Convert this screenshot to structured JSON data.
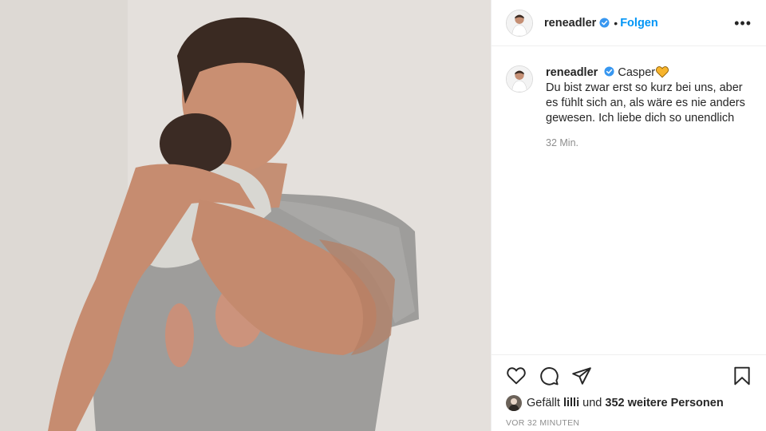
{
  "post": {
    "username": "reneadler",
    "follow_label": "Folgen",
    "separator": "•",
    "more_label": "•••"
  },
  "caption": {
    "username": "reneadler",
    "title": "Casper",
    "text": "Du bist zwar erst so kurz bei uns, aber es fühlt sich an, als wäre es nie anders gewesen. Ich liebe dich so unendlich",
    "time": "32 Min."
  },
  "likes": {
    "prefix": "Gefällt",
    "user": "lilli",
    "middle": "und",
    "count_text": "352 weitere Personen"
  },
  "posted_ago": "VOR 32 MINUTEN",
  "icons": {
    "like": "heart-outline-icon",
    "comment": "comment-icon",
    "share": "paper-plane-icon",
    "save": "bookmark-icon",
    "verified": "verified-badge-icon",
    "caption_emoji": "yellow-heart-icon"
  },
  "colors": {
    "link": "#0095f6",
    "verified": "#3897f0",
    "muted": "#8e8e8e",
    "heart_emoji": "#f7b42c"
  }
}
